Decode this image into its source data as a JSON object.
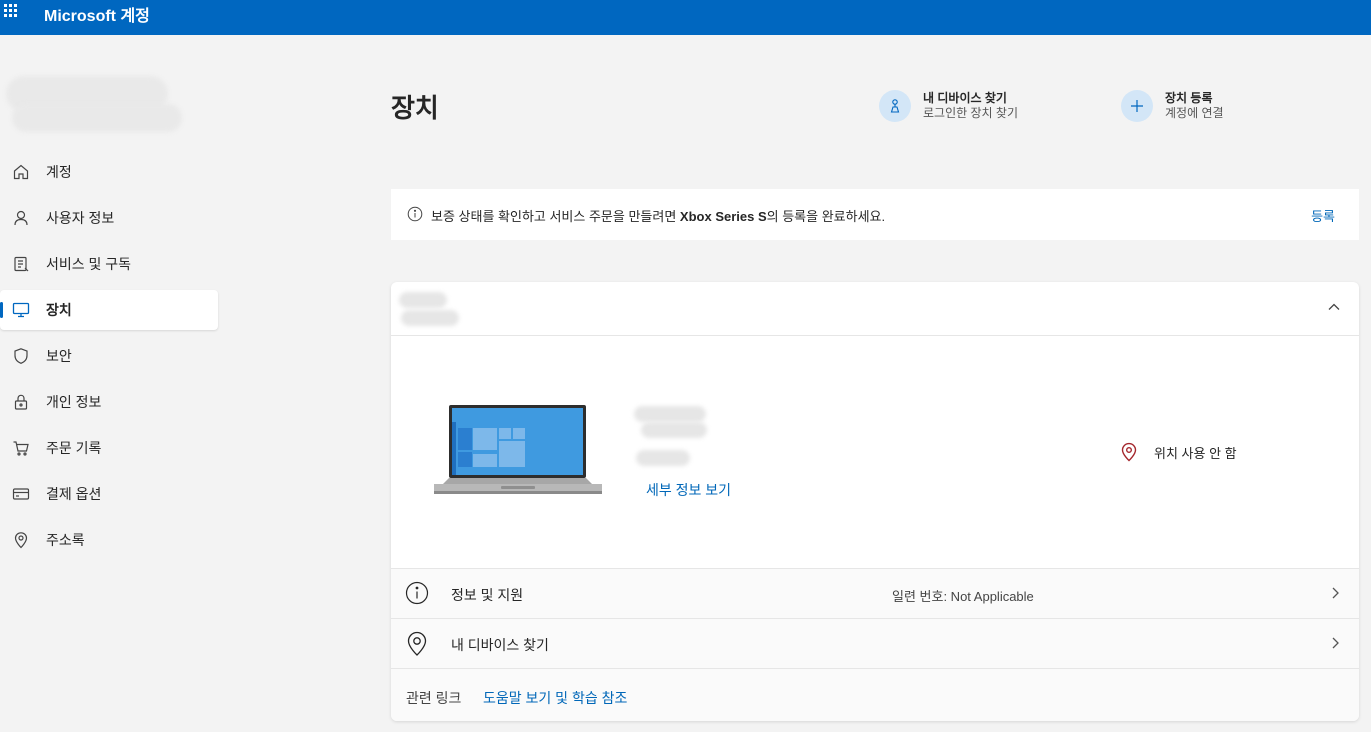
{
  "header": {
    "title": "Microsoft 계정",
    "waffle_icon": "app-launcher-icon",
    "color": "#0067c0"
  },
  "sidebar": {
    "items": [
      {
        "label": "계정",
        "icon": "home-icon",
        "active": false
      },
      {
        "label": "사용자 정보",
        "icon": "person-icon",
        "active": false
      },
      {
        "label": "서비스 및 구독",
        "icon": "subscription-icon",
        "active": false
      },
      {
        "label": "장치",
        "icon": "monitor-icon",
        "active": true
      },
      {
        "label": "보안",
        "icon": "shield-icon",
        "active": false
      },
      {
        "label": "개인 정보",
        "icon": "lock-icon",
        "active": false
      },
      {
        "label": "주문 기록",
        "icon": "cart-icon",
        "active": false
      },
      {
        "label": "결제 옵션",
        "icon": "credit-card-icon",
        "active": false
      },
      {
        "label": "주소록",
        "icon": "location-pin-icon",
        "active": false
      }
    ]
  },
  "main": {
    "title": "장치",
    "actions": {
      "find": {
        "title": "내 디바이스 찾기",
        "subtitle": "로그인한 장치 찾기",
        "icon": "find-device-icon"
      },
      "register": {
        "title": "장치 등록",
        "subtitle": "계정에 연결",
        "icon": "plus-icon"
      }
    },
    "banner": {
      "text_before": "보증 상태를 확인하고 서비스 주문을 만들려면 ",
      "text_bold": "Xbox Series S",
      "text_after": "의 등록을 완료하세요.",
      "link": "등록",
      "icon": "info-icon"
    },
    "device_card": {
      "details_link": "세부 정보 보기",
      "location_status": "위치 사용 안 함",
      "info_row": {
        "label": "정보 및 지원",
        "serial": "일련 번호: Not Applicable",
        "icon": "info-icon"
      },
      "find_row": {
        "label": "내 디바이스 찾기",
        "icon": "location-pin-icon"
      },
      "related": {
        "label": "관련 링크",
        "link": "도움말 보기 및 학습 참조"
      }
    }
  },
  "colors": {
    "accent": "#0067c0",
    "link": "#0067b8",
    "location_icon": "#a4262c"
  }
}
